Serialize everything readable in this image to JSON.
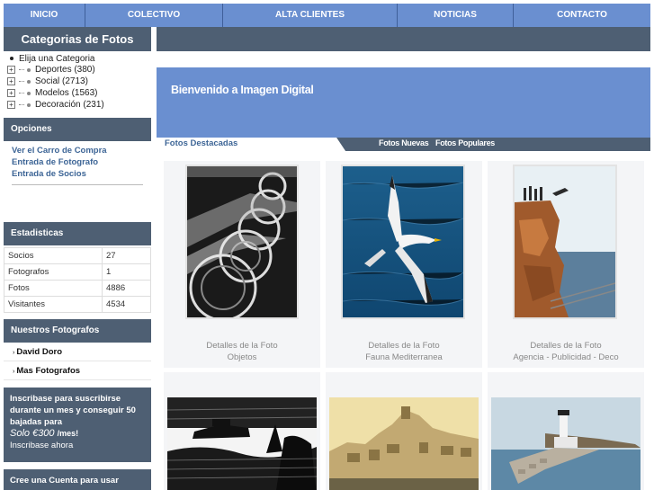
{
  "nav": [
    "INICIO",
    "COLECTIVO",
    "ALTA CLIENTES",
    "NOTICIAS",
    "CONTACTO"
  ],
  "sidebar": {
    "title": "Categorias de Fotos",
    "choose": "Elija una Categoria",
    "categories": [
      "Deportes (380)",
      "Social (2713)",
      "Modelos (1563)",
      "Decoración (231)"
    ],
    "options_title": "Opciones",
    "options": [
      "Ver el Carro de Compra",
      "Entrada de Fotografo",
      "Entrada de Socios"
    ],
    "stats_title": "Estadisticas",
    "stats": [
      {
        "label": "Socios",
        "value": "27"
      },
      {
        "label": "Fotografos",
        "value": "1"
      },
      {
        "label": "Fotos",
        "value": "4886"
      },
      {
        "label": "Visitantes",
        "value": "4534"
      }
    ],
    "photographers_title": "Nuestros Fotografos",
    "photographers": [
      "David Doro",
      "Mas Fotografos"
    ],
    "promo": {
      "text": "Inscribase para suscribirse durante un mes y conseguir 50 bajadas para",
      "price": "Solo €300",
      "per": "/mes!",
      "link": "Inscribase ahora"
    },
    "account": "Cree una Cuenta para usar"
  },
  "main": {
    "welcome": "Bienvenido a Imagen Digital",
    "tabs": [
      "Fotos Destacadas",
      "Fotos Nuevas",
      "Fotos Populares"
    ],
    "cards": [
      {
        "line1": "Detalles de la Foto",
        "line2": "Objetos"
      },
      {
        "line1": "Detalles de la Foto",
        "line2": "Fauna Mediterranea"
      },
      {
        "line1": "Detalles de la Foto",
        "line2": "Agencia - Publicidad - Deco"
      }
    ]
  },
  "colors": {
    "nav": "#6a8fd0",
    "panel": "#4e5f73",
    "link": "#3d6596"
  }
}
